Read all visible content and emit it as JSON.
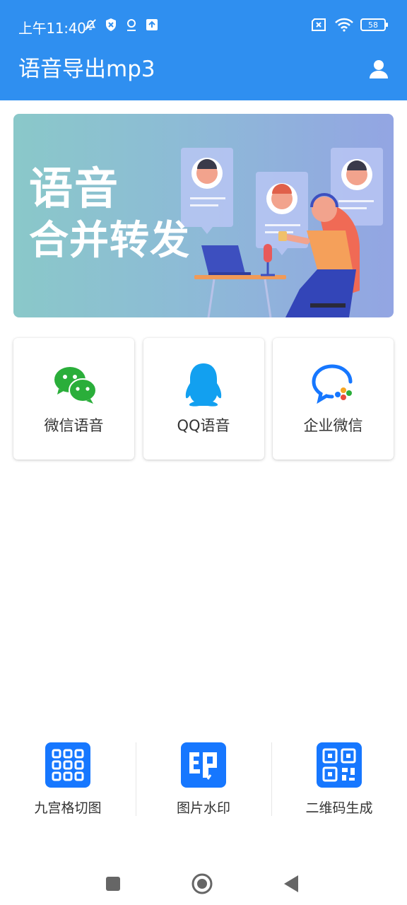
{
  "status_bar": {
    "time": "上午11:40",
    "battery": "58",
    "icons": [
      "bell-off-icon",
      "shield-icon",
      "location-icon",
      "upload-icon",
      "sim-x-icon",
      "wifi-icon",
      "battery-icon"
    ]
  },
  "app_bar": {
    "title": "语音导出mp3",
    "user_icon": "user-icon"
  },
  "banner": {
    "line1": "语音",
    "line2": "合并转发"
  },
  "cards": [
    {
      "label": "微信语音",
      "icon": "wechat-icon",
      "color": "#2aae3a"
    },
    {
      "label": "QQ语音",
      "icon": "qq-penguin-icon",
      "color": "#12a0f0"
    },
    {
      "label": "企业微信",
      "icon": "wecom-icon",
      "color": "#1677ff"
    }
  ],
  "tools": [
    {
      "label": "九宫格切图",
      "icon": "grid-icon"
    },
    {
      "label": "图片水印",
      "icon": "stamp-icon"
    },
    {
      "label": "二维码生成",
      "icon": "qrcode-icon"
    }
  ],
  "navbar": {
    "recents": "recents-icon",
    "home": "home-icon",
    "back": "back-icon"
  },
  "colors": {
    "primary": "#2f8ff0",
    "tool_blue": "#1677ff"
  }
}
